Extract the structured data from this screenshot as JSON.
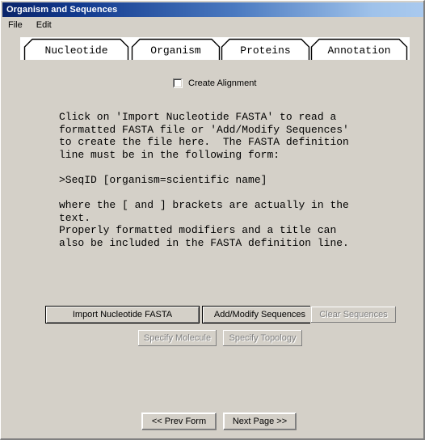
{
  "window": {
    "title": "Organism and Sequences",
    "accent_title_start": "#0a246a",
    "accent_title_end": "#a9c9ee",
    "face_color": "#d4d0c8"
  },
  "menubar": {
    "items": [
      {
        "label": "File"
      },
      {
        "label": "Edit"
      }
    ]
  },
  "tabs": [
    {
      "label": "Nucleotide",
      "selected": true
    },
    {
      "label": "Organism",
      "selected": false
    },
    {
      "label": "Proteins",
      "selected": false
    },
    {
      "label": "Annotation",
      "selected": false
    }
  ],
  "panel": {
    "checkbox": {
      "label": "Create Alignment",
      "checked": false
    },
    "instructions": "Click on 'Import Nucleotide FASTA' to read a\nformatted FASTA file or 'Add/Modify Sequences'\nto create the file here.  The FASTA definition\nline must be in the following form:\n\n>SeqID [organism=scientific name]\n\nwhere the [ and ] brackets are actually in the\ntext.\nProperly formatted modifiers and a title can\nalso be included in the FASTA definition line.",
    "buttons": {
      "import_nucleotide_fasta": "Import Nucleotide FASTA",
      "add_modify_sequences": "Add/Modify Sequences",
      "clear_sequences": "Clear Sequences",
      "specify_molecule": "Specify Molecule",
      "specify_topology": "Specify Topology"
    },
    "navigation": {
      "prev_form": "<< Prev Form",
      "next_page": "Next Page >>"
    }
  }
}
